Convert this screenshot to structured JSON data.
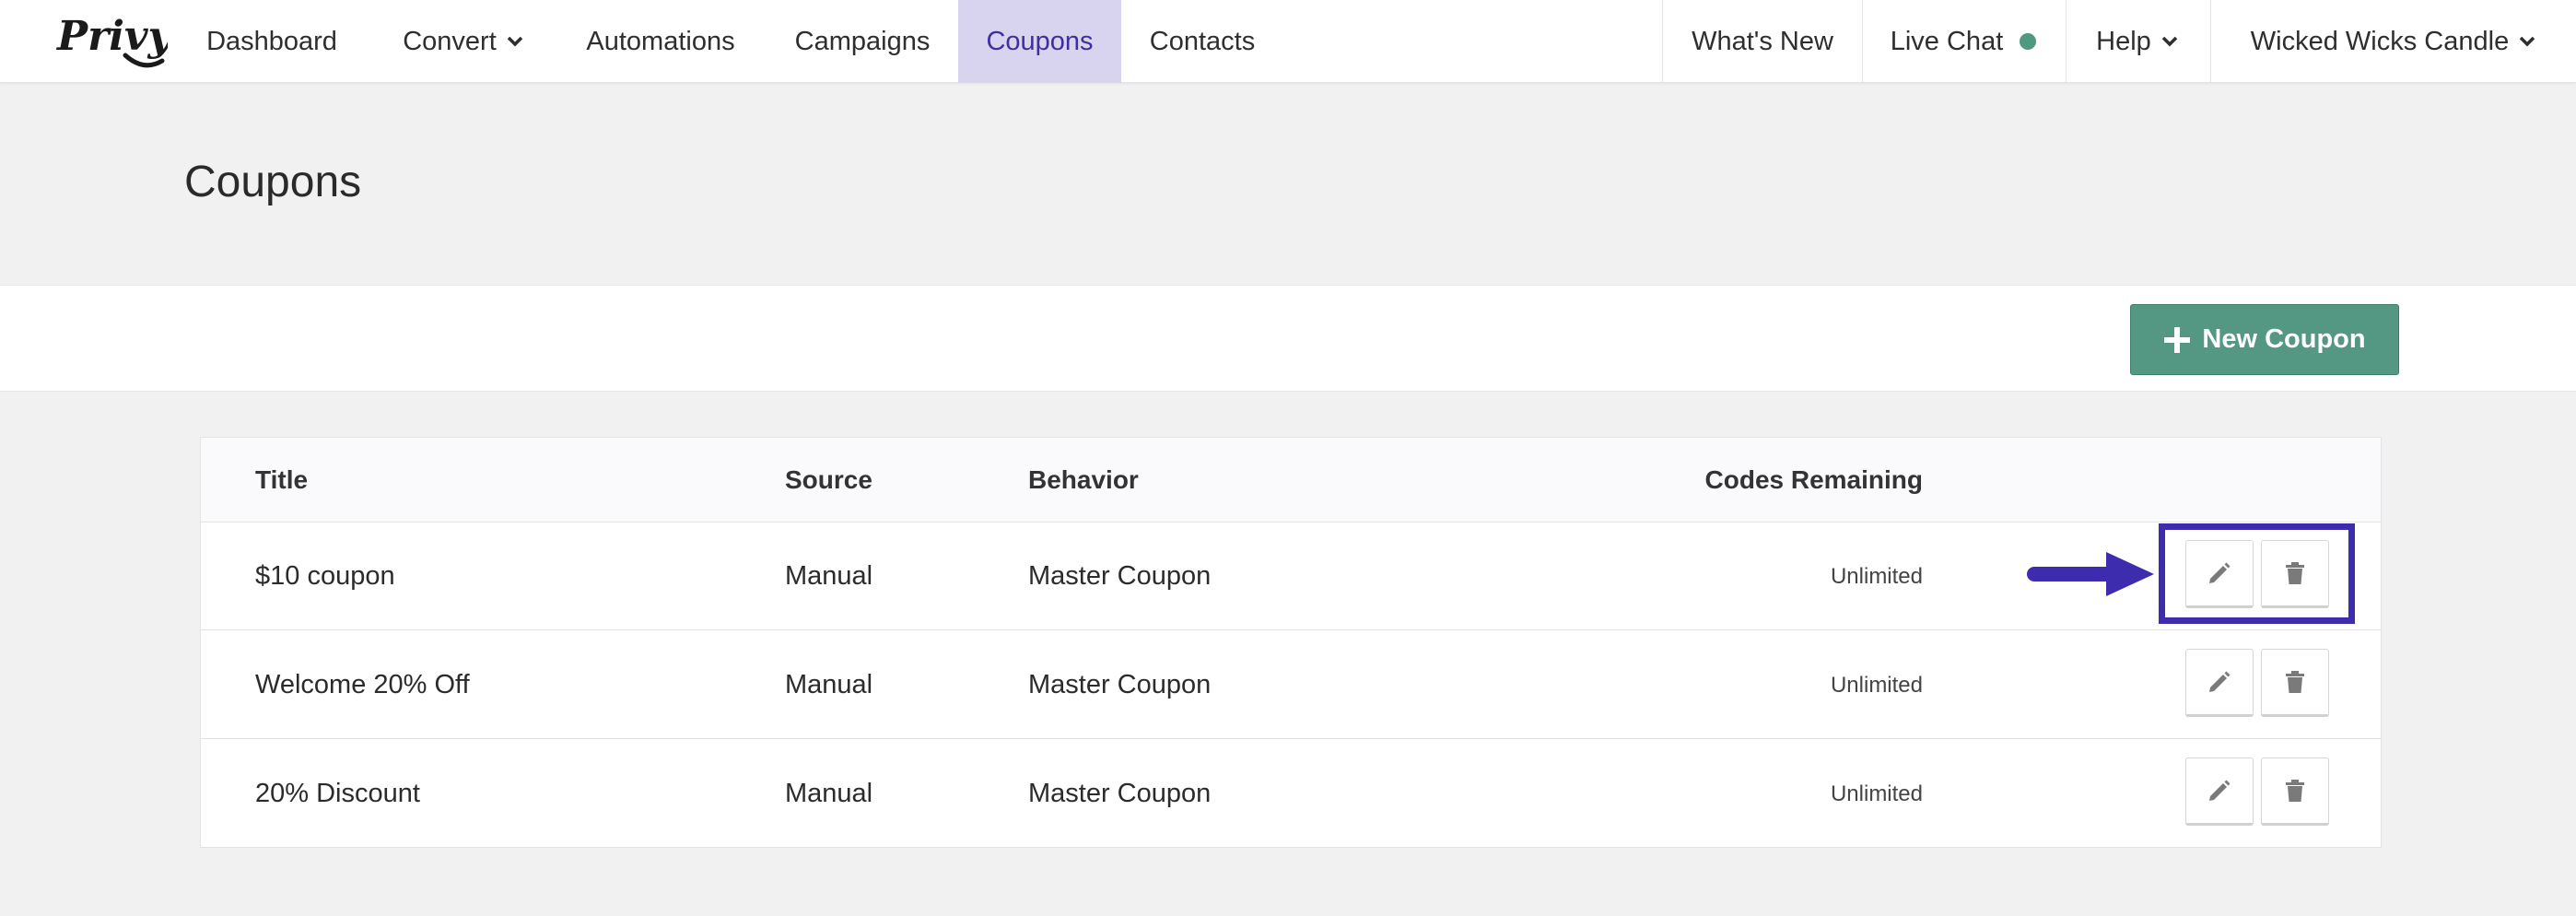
{
  "nav": {
    "logo_text": "Privy",
    "items": [
      {
        "label": "Dashboard",
        "has_dropdown": false,
        "active": false
      },
      {
        "label": "Convert",
        "has_dropdown": true,
        "active": false
      },
      {
        "label": "Automations",
        "has_dropdown": false,
        "active": false
      },
      {
        "label": "Campaigns",
        "has_dropdown": false,
        "active": false
      },
      {
        "label": "Coupons",
        "has_dropdown": false,
        "active": true
      },
      {
        "label": "Contacts",
        "has_dropdown": false,
        "active": false
      }
    ],
    "right": {
      "whats_new": "What's New",
      "live_chat": "Live Chat",
      "live_chat_status_color": "#4e9a81",
      "help": "Help",
      "account": "Wicked Wicks Candle"
    },
    "active_color": "#d8d3ef"
  },
  "page": {
    "title": "Coupons"
  },
  "actions": {
    "new_coupon_label": "New Coupon",
    "new_coupon_icon": "plus-icon",
    "button_color": "#549782"
  },
  "table": {
    "headers": {
      "title": "Title",
      "source": "Source",
      "behavior": "Behavior",
      "codes_remaining": "Codes Remaining"
    },
    "rows": [
      {
        "title": "$10 coupon",
        "source": "Manual",
        "behavior": "Master Coupon",
        "codes_remaining": "Unlimited",
        "highlighted": true
      },
      {
        "title": "Welcome 20% Off",
        "source": "Manual",
        "behavior": "Master Coupon",
        "codes_remaining": "Unlimited",
        "highlighted": false
      },
      {
        "title": "20% Discount",
        "source": "Manual",
        "behavior": "Master Coupon",
        "codes_remaining": "Unlimited",
        "highlighted": false
      }
    ],
    "row_actions": [
      "pencil-icon",
      "trash-icon"
    ]
  },
  "annotation": {
    "color": "#3d2cae",
    "target": "first row edit and delete buttons"
  }
}
